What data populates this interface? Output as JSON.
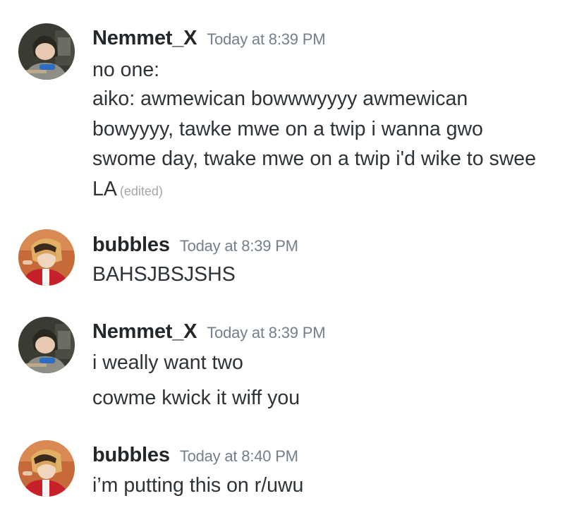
{
  "messages": [
    {
      "author": "Nemmet_X",
      "timestamp": "Today at 8:39 PM",
      "avatar_icon": "anime-boy-gaming-avatar",
      "lines": [
        "no one:",
        "aiko: awmewican bowwwyyyy awmewican",
        "bowyyyy, tawke mwe on a twip i wanna gwo",
        "swome day, twake mwe on a twip i'd wike to swee",
        "LA"
      ],
      "edited": "(edited)"
    },
    {
      "author": "bubbles",
      "timestamp": "Today at 8:39 PM",
      "avatar_icon": "anime-boy-red-jacket-avatar",
      "lines": [
        "BAHSJBSJSHS"
      ]
    },
    {
      "author": "Nemmet_X",
      "timestamp": "Today at 8:39 PM",
      "avatar_icon": "anime-boy-gaming-avatar",
      "lines": [
        "i weally want two",
        "cowme kwick it wiff you"
      ]
    },
    {
      "author": "bubbles",
      "timestamp": "Today at 8:40 PM",
      "avatar_icon": "anime-boy-red-jacket-avatar",
      "lines": [
        "i’m putting this on r/uwu"
      ]
    }
  ]
}
